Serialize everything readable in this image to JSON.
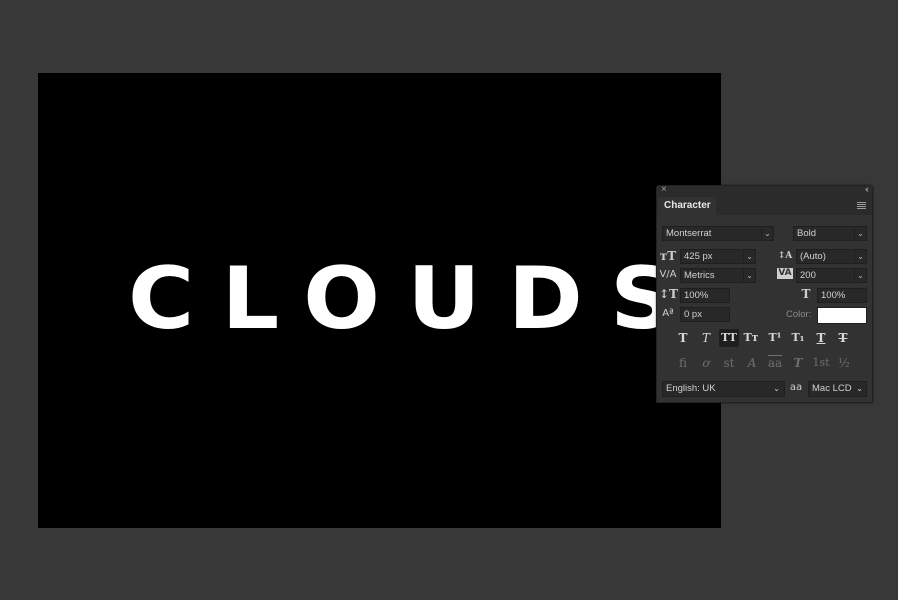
{
  "canvas": {
    "text": "CLOUDS",
    "background": "#000000",
    "text_color": "#ffffff"
  },
  "panel": {
    "close_icon": "close-icon",
    "collapse_icon": "double-chevron-left-icon",
    "tab_label": "Character",
    "menu_icon": "hamburger-menu-icon",
    "font_family": "Montserrat",
    "font_style": "Bold",
    "font_size": "425 px",
    "leading": "(Auto)",
    "kerning": "Metrics",
    "tracking": "200",
    "vertical_scale": "100%",
    "horizontal_scale": "100%",
    "baseline_shift": "0 px",
    "color_label": "Color:",
    "color_value": "#ffffff",
    "dropdown_glyph": "⌄",
    "style_buttons": [
      {
        "name": "faux-bold",
        "glyph": "T",
        "active": false
      },
      {
        "name": "faux-italic",
        "glyph": "T",
        "active": false
      },
      {
        "name": "all-caps",
        "glyph": "TT",
        "active": true
      },
      {
        "name": "small-caps",
        "glyph": "Tт",
        "active": false
      },
      {
        "name": "superscript",
        "glyph": "T¹",
        "active": false
      },
      {
        "name": "subscript",
        "glyph": "T₁",
        "active": false
      },
      {
        "name": "underline",
        "glyph": "T",
        "active": false
      },
      {
        "name": "strikethrough",
        "glyph": "T",
        "active": false
      }
    ],
    "opentype_buttons": [
      {
        "name": "standard-ligatures",
        "glyph": "fi"
      },
      {
        "name": "contextual-alternates",
        "glyph": "ơ"
      },
      {
        "name": "discretionary-ligatures",
        "glyph": "st"
      },
      {
        "name": "swash",
        "glyph": "A"
      },
      {
        "name": "stylistic-alternates",
        "glyph": "aa"
      },
      {
        "name": "titling-alternates",
        "glyph": "T"
      },
      {
        "name": "ordinals",
        "glyph": "1st"
      },
      {
        "name": "fractions",
        "glyph": "½"
      }
    ],
    "language": "English: UK",
    "antialias_icon": "aa",
    "antialias": "Mac LCD"
  }
}
